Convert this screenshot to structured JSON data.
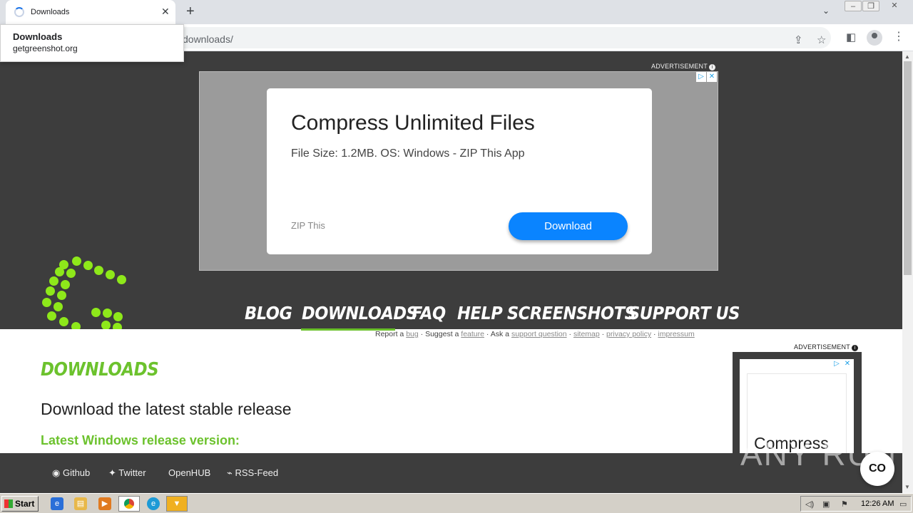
{
  "browser": {
    "tab_title": "Downloads",
    "new_tab": "+",
    "close": "✕",
    "url": "downloads/",
    "popup_title": "Downloads",
    "popup_domain": "getgreenshot.org"
  },
  "ad_label": "ADVERTISEMENT",
  "ad_top": {
    "title": "Compress Unlimited Files",
    "description": "File Size: 1.2MB. OS: Windows - ZIP This App",
    "brand": "ZIP This",
    "button": "Download"
  },
  "nav": {
    "items": [
      "BLOG",
      "DOWNLOADS",
      "FAQ",
      "HELP",
      "SCREENSHOTS",
      "SUPPORT US"
    ],
    "active": "DOWNLOADS"
  },
  "subnav": {
    "report_a": "Report a",
    "bug": "bug",
    "suggest_a": "Suggest a",
    "feature": "feature",
    "ask_a": "Ask a",
    "support_question": "support question",
    "sitemap": "sitemap",
    "privacy_policy": "privacy policy",
    "impressum": "impressum"
  },
  "content": {
    "heading": "DOWNLOADS",
    "subheading": "Download the latest stable release",
    "windows_heading": "Latest Windows release version:"
  },
  "side_ad": {
    "text": "Compress Unlimited"
  },
  "footer": {
    "links": [
      "Github",
      "Twitter",
      "OpenHUB",
      "RSS-Feed"
    ]
  },
  "watermark": "ANY RUN",
  "co_button": "CO",
  "taskbar": {
    "start": "Start",
    "clock": "12:26 AM"
  },
  "colors": {
    "brand_green": "#6cc22d",
    "dark_bg": "#3d3d3d",
    "ad_button": "#0a84ff"
  }
}
